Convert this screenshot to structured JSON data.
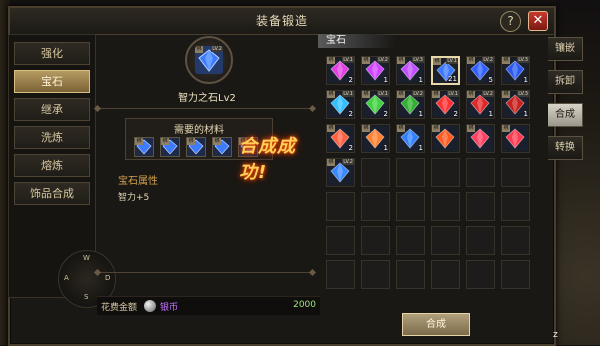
{
  "window": {
    "title": "装备锻造",
    "help": "?",
    "close": "✕"
  },
  "menu": {
    "items": [
      {
        "label": "强化"
      },
      {
        "label": "宝石"
      },
      {
        "label": "继承"
      },
      {
        "label": "洗炼"
      },
      {
        "label": "熔炼"
      },
      {
        "label": "饰品合成"
      }
    ],
    "active_index": 1
  },
  "joystick": {
    "up": "W",
    "left": "A",
    "right": "D",
    "down": "S"
  },
  "target": {
    "name": "智力之石Lv2",
    "badge": "绑",
    "level": "LV.2"
  },
  "materials": {
    "title": "需要的材料",
    "count": 5,
    "badge": "绑"
  },
  "success_text": "合成成功!",
  "attributes": {
    "title": "宝石属性",
    "line": "智力+5"
  },
  "cost": {
    "label": "花费金额",
    "currency": "银币",
    "amount": "2000"
  },
  "inventory": {
    "tab": "宝石",
    "columns": 6,
    "rows": 7,
    "items": [
      {
        "color": "#e040e0",
        "badge": "绑",
        "level": "LV.1",
        "qty": "2"
      },
      {
        "color": "#d040ff",
        "badge": "绑",
        "level": "LV.2",
        "qty": "1"
      },
      {
        "color": "#c050ff",
        "badge": "绑",
        "level": "LV.3",
        "qty": "1"
      },
      {
        "color": "#3a78ff",
        "badge": "绑",
        "level": "LV.1",
        "qty": "21",
        "selected": true
      },
      {
        "color": "#2f60ff",
        "badge": "绑",
        "level": "LV.2",
        "qty": "5"
      },
      {
        "color": "#2a58f0",
        "badge": "绑",
        "level": "LV.3",
        "qty": "1"
      },
      {
        "color": "#30c0ff",
        "badge": "绑",
        "level": "LV.1",
        "qty": "2"
      },
      {
        "color": "#40d040",
        "badge": "绑",
        "level": "LV.1",
        "qty": "2"
      },
      {
        "color": "#30b030",
        "badge": "绑",
        "level": "LV.2",
        "qty": "1"
      },
      {
        "color": "#ff3030",
        "badge": "绑",
        "level": "LV.1",
        "qty": "2"
      },
      {
        "color": "#e02828",
        "badge": "绑",
        "level": "LV.2",
        "qty": "1"
      },
      {
        "color": "#c8201c",
        "badge": "绑",
        "level": "LV.3",
        "qty": "1"
      },
      {
        "color": "#ff6040",
        "badge": "绑",
        "level": "",
        "qty": "2"
      },
      {
        "color": "#ff8030",
        "badge": "绑",
        "level": "",
        "qty": "1"
      },
      {
        "color": "#3080ff",
        "badge": "绑",
        "level": "",
        "qty": "1"
      },
      {
        "color": "#ff5a20",
        "badge": "绑",
        "level": "",
        "qty": ""
      },
      {
        "color": "#ff4060",
        "badge": "绑",
        "level": "",
        "qty": ""
      },
      {
        "color": "#ff3a50",
        "badge": "绑",
        "level": "",
        "qty": ""
      },
      {
        "color": "#3a88ff",
        "badge": "绑",
        "level": "LV.2",
        "qty": ""
      }
    ]
  },
  "side_tabs": [
    {
      "label": "镶嵌"
    },
    {
      "label": "拆卸"
    },
    {
      "label": "合成"
    },
    {
      "label": "转换"
    }
  ],
  "side_tabs_active_index": 2,
  "compose_button": "合成",
  "z_key": "Z"
}
